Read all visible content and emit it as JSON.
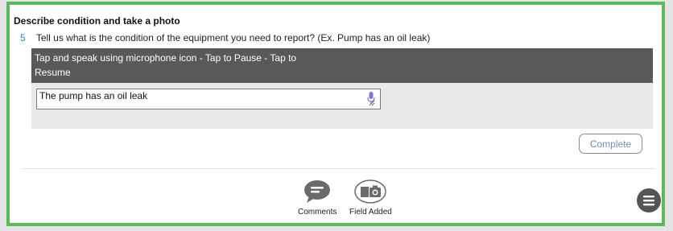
{
  "section": {
    "title": "Describe condition and take a photo"
  },
  "question": {
    "number": "5",
    "text": "Tell us what is the condition of the equipment you need to report? (Ex. Pump has an oil leak)"
  },
  "panel": {
    "instruction": "Tap and speak using microphone icon - Tap to Pause - Tap to Resume",
    "input_value": "The pump has an oil leak",
    "mic_icon": "microphone-icon"
  },
  "actions": {
    "complete_label": "Complete"
  },
  "bottom_bar": {
    "comments": {
      "label": "Comments",
      "icon": "speech-bubble-icon"
    },
    "field_added": {
      "label": "Field Added",
      "icon": "camera-icon"
    },
    "menu_icon": "hamburger-menu-icon"
  },
  "colors": {
    "frame_border": "#5cb85c",
    "header_bg": "#595959",
    "question_number": "#2f7fc1"
  }
}
